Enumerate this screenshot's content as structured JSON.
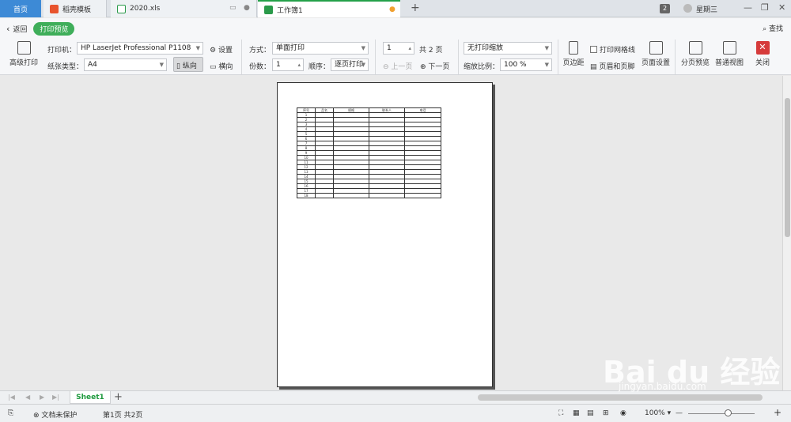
{
  "tabs": {
    "home": "首页",
    "daoke": "稻壳模板",
    "xls": "2020.xls",
    "book": "工作簿1",
    "badge": "2",
    "user": "星期三"
  },
  "toolbar": {
    "back": "返回",
    "preview": "打印预览",
    "search": "查找",
    "advanced_print": "高级打印",
    "printer_label": "打印机：",
    "printer_value": "HP LaserJet Professional P1108",
    "settings": "设置",
    "paper_label": "纸张类型：",
    "paper_value": "A4",
    "portrait": "纵向",
    "landscape": "横向",
    "mode_label": "方式：",
    "mode_value": "单面打印",
    "copies_label": "份数：",
    "copies_value": "1",
    "order_label": "顺序：",
    "order_value": "逐页打印",
    "page_value": "1",
    "page_total": "共 2 页",
    "prev_page": "上一页",
    "next_page": "下一页",
    "scale_value": "无打印缩放",
    "zoom_label": "缩放比例：",
    "zoom_value": "100 %",
    "margins": "页边距",
    "gridlines": "打印网格线",
    "header_footer": "页眉和页脚",
    "page_setup": "页面设置",
    "page_break_preview": "分页预览",
    "normal_view": "普通视图",
    "close": "关闭"
  },
  "sheet_table": {
    "headers": [
      "序号",
      "品名",
      "规格",
      "联系人",
      "电话"
    ],
    "rows": [
      "1",
      "2",
      "3",
      "4",
      "5",
      "6",
      "7",
      "8",
      "9",
      "10",
      "11",
      "12",
      "13",
      "14",
      "15",
      "16",
      "17",
      "18"
    ]
  },
  "sheetbar": {
    "sheet_name": "Sheet1"
  },
  "status": {
    "protect": "文档未保护",
    "page_info": "第1页 共2页",
    "zoom": "100%"
  },
  "watermark": {
    "main": "Bai du 经验",
    "sub": "jingyan.baidu.com"
  }
}
